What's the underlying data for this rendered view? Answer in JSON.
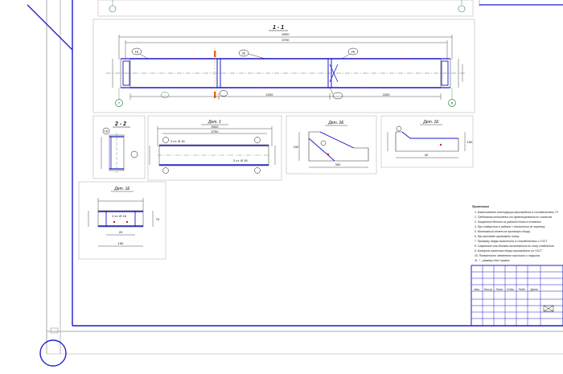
{
  "colors": {
    "frame": "#1c1ccc",
    "rebar": "#1818c8",
    "accent_orange": "#e86a12",
    "accent_green": "#2a8a4a",
    "annotation": "#2020d0",
    "dim": "#222222",
    "sheet_border": "#a8a8a8"
  },
  "section_1_1": {
    "title": "1 - 1",
    "dims_top": [
      "6000",
      "1500",
      "5700"
    ],
    "mark_left": "1E",
    "mark_mid": "2E",
    "mark_right": "2E",
    "axis_left": "7",
    "axis_right": "6",
    "bottom_dims": [
      "150",
      "2200",
      "2200",
      "150"
    ]
  },
  "section_2_2": {
    "title": "2 - 2",
    "mark": "1E"
  },
  "detail_1": {
    "title": "Дет. 1",
    "dims": [
      "5900",
      "5750"
    ],
    "note_a": "2 ст. Ø 16",
    "note_b": "2 ст. Ø 16"
  },
  "detail_2": {
    "title": "Дет. 2Е",
    "dims": [
      "300",
      "150",
      "150"
    ]
  },
  "detail_3": {
    "title": "Дет. 1Е",
    "dims": [
      "300",
      "150",
      "40"
    ]
  },
  "detail_4": {
    "title": "Дет. 1Е",
    "note": "2 ст. Ø 16",
    "dims": [
      "150",
      "20",
      "70"
    ]
  },
  "notes": {
    "heading": "Примечания",
    "lines": [
      "1. Изготовление конструкции производить в соответствии ТУ",
      "2. Требования отношения от проектирования по согласию",
      "3. Защитные детали из угловой стали в основном",
      "4. При отверстии к работе с точностью по чертежу",
      "5. Монтажный ответ на принятую сборку",
      "6. При монтаже принимать точку",
      "7. Проверку сварки выполнить в соответствии с ГОСТ",
      "8. Сварочные швы должны выполняться по типу соединения",
      "9. Контроль качества сборки производить по ГОСТ",
      "10. Поверхность элементов очистить и покрыть",
      "11. * - размеры для справок"
    ]
  },
  "title_block": {
    "cols": [
      "Изм.",
      "Кол.уч",
      "Лист",
      "N док.",
      "Подп.",
      "Дата"
    ]
  }
}
